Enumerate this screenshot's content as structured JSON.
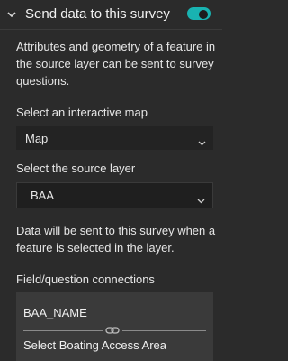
{
  "section": {
    "title": "Send data to this survey",
    "toggle_on": true,
    "accent_color": "#19b3b1",
    "chevron_icon": "chevron-down-icon"
  },
  "description": "Attributes and geometry of a feature in the source layer can be sent to survey questions.",
  "interactive_map": {
    "label": "Select an interactive map",
    "value": "Map"
  },
  "source_layer": {
    "label": "Select the source layer",
    "value": "BAA"
  },
  "note": "Data will be sent to this survey when a feature is selected in the layer.",
  "connections": {
    "label": "Field/question connections",
    "items": [
      {
        "field": "BAA_NAME",
        "question": "Select Boating Access Area",
        "link_icon": "link-icon"
      }
    ]
  }
}
